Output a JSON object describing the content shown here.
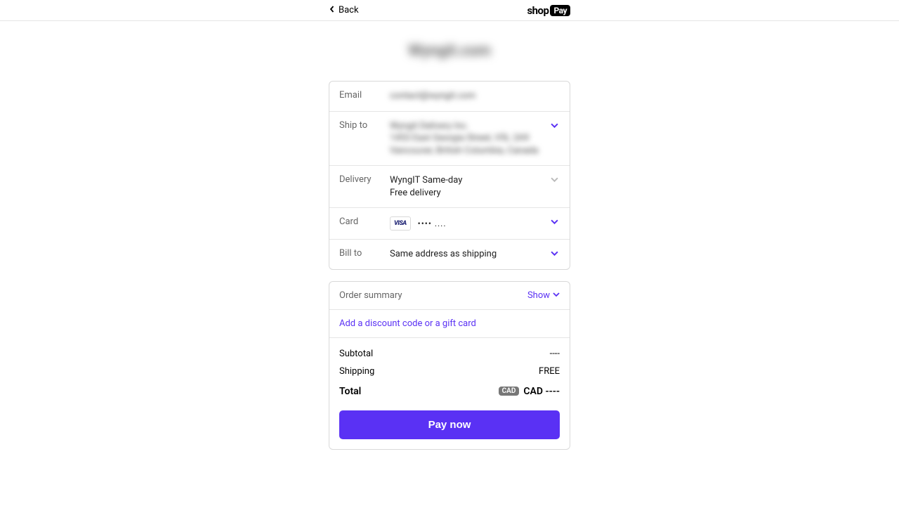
{
  "header": {
    "back_label": "Back",
    "shop_word": "shop",
    "pay_word": "Pay"
  },
  "site_title": "Wyngit.com",
  "rows": {
    "email": {
      "label": "Email",
      "value": "contact@wyngit.com"
    },
    "ship": {
      "label": "Ship to",
      "value": "Wyngit Delivery Inc.\n1453 East Georgia Street, V5L 2A9\nVancouver, British Columbia, Canada"
    },
    "delivery": {
      "label": "Delivery",
      "line1": "WyngIT Same-day",
      "line2": "Free delivery"
    },
    "card": {
      "label": "Card",
      "brand": "VISA",
      "mask": "•••• ...."
    },
    "bill": {
      "label": "Bill to",
      "value": "Same address as shipping"
    }
  },
  "summary": {
    "title": "Order summary",
    "show": "Show",
    "discount_link": "Add a discount code or a gift card",
    "subtotal_label": "Subtotal",
    "subtotal_value": "----",
    "shipping_label": "Shipping",
    "shipping_value": "FREE",
    "total_label": "Total",
    "total_badge": "CAD",
    "total_currency": "CAD",
    "total_value": "----"
  },
  "pay_button": "Pay now"
}
